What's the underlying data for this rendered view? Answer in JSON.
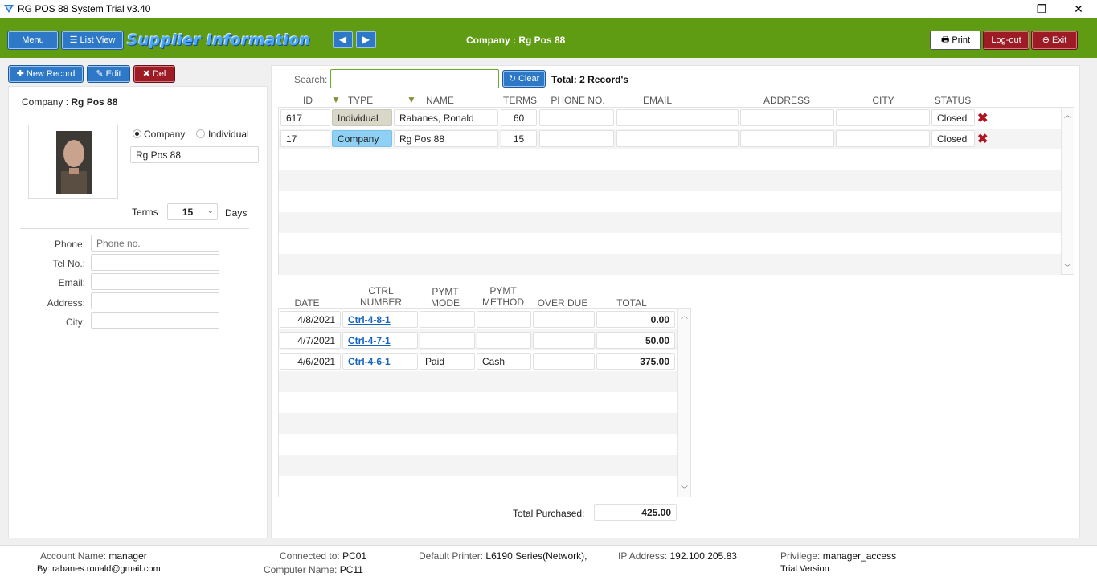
{
  "window": {
    "title": "RG POS 88 System Trial v3.40",
    "minimize": "—",
    "maximize": "❐",
    "close": "✕"
  },
  "header": {
    "menu_label": "Menu",
    "listview_label": "List View",
    "page_title": "Supplier Information",
    "company_label": "Company : Rg Pos 88",
    "print_label": "Print",
    "logout_label": "Log-out",
    "exit_label": "Exit"
  },
  "toolbar": {
    "new_label": "New Record",
    "edit_label": "Edit",
    "del_label": "Del"
  },
  "left": {
    "company_caption": "Company :",
    "company_value": "Rg Pos 88",
    "radio_company": "Company",
    "radio_individual": "Individual",
    "name_value": "Rg Pos 88",
    "terms_label": "Terms",
    "terms_value": "15",
    "days_label": "Days",
    "phone_label": "Phone:",
    "phone_placeholder": "Phone no.",
    "tel_label": "Tel No.:",
    "email_label": "Email:",
    "address_label": "Address:",
    "city_label": "City:"
  },
  "search": {
    "label": "Search:",
    "value": "",
    "clear_label": "Clear",
    "total": "Total: 2 Record's"
  },
  "supplier_table": {
    "headers": [
      "ID",
      "TYPE",
      "NAME",
      "TERMS",
      "PHONE NO.",
      "EMAIL",
      "ADDRESS",
      "CITY",
      "STATUS"
    ],
    "rows": [
      {
        "id": "617",
        "type": "Individual",
        "name": "Rabanes,  Ronald",
        "terms": "60",
        "phone": "",
        "email": "",
        "address": "",
        "city": "",
        "status": "Closed"
      },
      {
        "id": "17",
        "type": "Company",
        "name": "Rg Pos 88",
        "terms": "15",
        "phone": "",
        "email": "",
        "address": "",
        "city": "",
        "status": "Closed"
      }
    ]
  },
  "purchase_table": {
    "headers": {
      "date": "DATE",
      "ctrl": [
        "CTRL",
        "NUMBER"
      ],
      "mode": [
        "PYMT",
        "MODE"
      ],
      "method": [
        "PYMT",
        "METHOD"
      ],
      "overdue": "OVER DUE",
      "total": "TOTAL"
    },
    "rows": [
      {
        "date": "4/8/2021",
        "ctrl": "Ctrl-4-8-1",
        "mode": "",
        "method": "",
        "overdue": "",
        "total": "0.00"
      },
      {
        "date": "4/7/2021",
        "ctrl": "Ctrl-4-7-1",
        "mode": "",
        "method": "",
        "overdue": "",
        "total": "50.00"
      },
      {
        "date": "4/6/2021",
        "ctrl": "Ctrl-4-6-1",
        "mode": "Paid",
        "method": "Cash",
        "overdue": "",
        "total": "375.00"
      }
    ],
    "total_purchased_label": "Total Purchased:",
    "total_purchased_value": "425.00"
  },
  "status_bar": {
    "account_label": "Account Name:",
    "account_value": "manager",
    "by_label": "By:",
    "by_value": "rabanes.ronald@gmail.com",
    "connected_label": "Connected to:",
    "connected_value": "PC01",
    "computer_label": "Computer Name:",
    "computer_value": "PC11",
    "printer_label": "Default Printer:",
    "printer_value": "L6190 Series(Network),",
    "ip_label": "IP Address:",
    "ip_value": "192.100.205.83",
    "privilege_label": "Privilege:",
    "privilege_value": "manager_access",
    "trial_label": "Trial Version"
  },
  "colors": {
    "header_green": "#5f9c13",
    "accent_blue": "#2e79c7",
    "danger_red": "#9d1b24",
    "link_blue": "#1565c0",
    "type_company_bg": "#8fd0f5",
    "type_individual_bg": "#d9d7c8"
  }
}
